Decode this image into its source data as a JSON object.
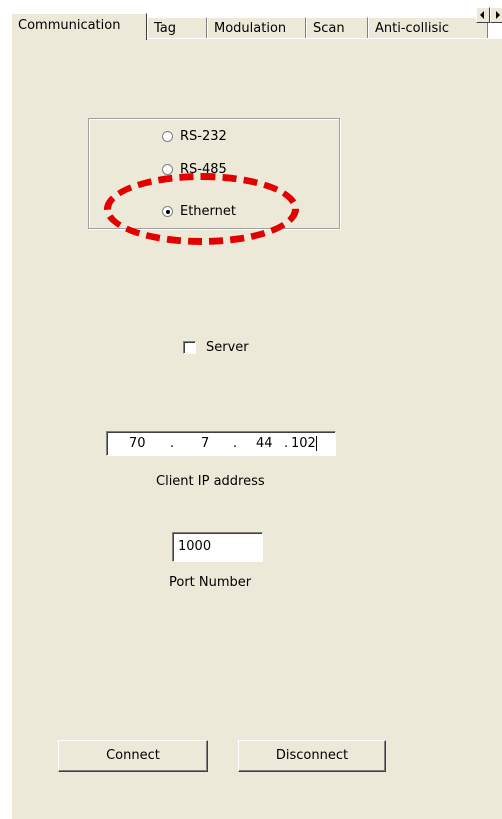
{
  "tabs": [
    {
      "label": "Communication",
      "active": true
    },
    {
      "label": "Tag",
      "active": false
    },
    {
      "label": "Modulation",
      "active": false
    },
    {
      "label": "Scan",
      "active": false
    },
    {
      "label": "Anti-collisic",
      "active": false
    }
  ],
  "tab_scroll": {
    "left_icon": "arrow-left-icon",
    "right_icon": "arrow-right-icon"
  },
  "interface_options": [
    {
      "label": "RS-232",
      "selected": false
    },
    {
      "label": "RS-485",
      "selected": false
    },
    {
      "label": "Ethernet",
      "selected": true
    }
  ],
  "highlight_color": "#e20000",
  "server_checkbox": {
    "label": "Server",
    "checked": false
  },
  "client_ip": {
    "octets": [
      "70",
      "7",
      "44",
      "102"
    ],
    "separator": ".",
    "caption": "Client IP address"
  },
  "port": {
    "value": "1000",
    "caption": "Port Number"
  },
  "buttons": {
    "connect": "Connect",
    "disconnect": "Disconnect"
  }
}
